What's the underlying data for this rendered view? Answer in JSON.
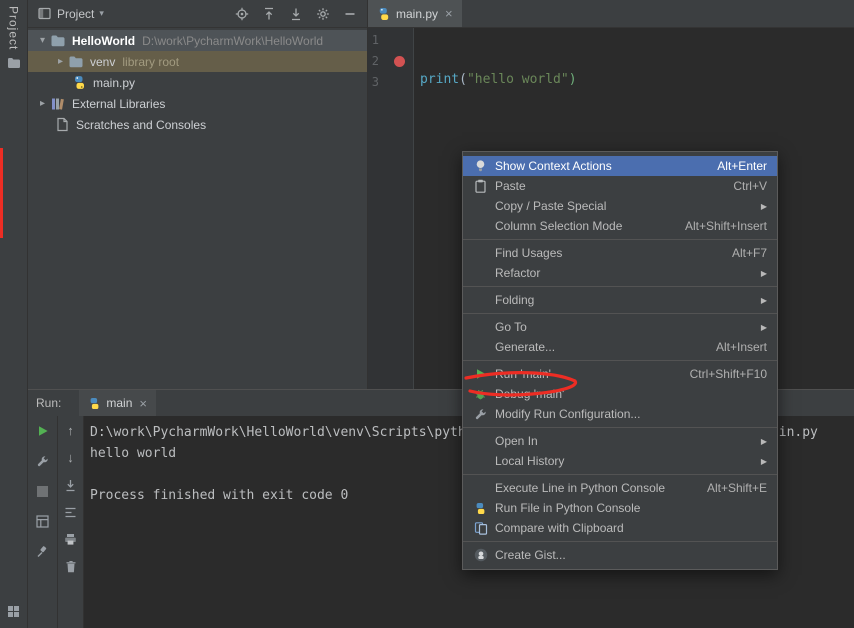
{
  "left_strip": {
    "label": "Project"
  },
  "project_panel": {
    "title": "Project",
    "tree": [
      {
        "name": "HelloWorld",
        "detail": "D:\\work\\PycharmWork\\HelloWorld"
      },
      {
        "name": "venv",
        "detail": "library root"
      },
      {
        "name": "main.py",
        "detail": ""
      },
      {
        "name": "External Libraries",
        "detail": ""
      },
      {
        "name": "Scratches and Consoles",
        "detail": ""
      }
    ]
  },
  "editor": {
    "tab_label": "main.py",
    "line_numbers": [
      "1",
      "2",
      "3"
    ],
    "code": {
      "builtin": "print",
      "open_paren": "(",
      "string": "\"hello world\"",
      "close_paren": ")"
    }
  },
  "context_menu": {
    "items": [
      {
        "label": "Show Context Actions",
        "shortcut": "Alt+Enter"
      },
      {
        "label": "Paste",
        "shortcut": "Ctrl+V"
      },
      {
        "label": "Copy / Paste Special",
        "shortcut": ""
      },
      {
        "label": "Column Selection Mode",
        "shortcut": "Alt+Shift+Insert"
      },
      {
        "label": "Find Usages",
        "shortcut": "Alt+F7"
      },
      {
        "label": "Refactor",
        "shortcut": ""
      },
      {
        "label": "Folding",
        "shortcut": ""
      },
      {
        "label": "Go To",
        "shortcut": ""
      },
      {
        "label": "Generate...",
        "shortcut": "Alt+Insert"
      },
      {
        "label": "Run 'main'",
        "shortcut": "Ctrl+Shift+F10"
      },
      {
        "label": "Debug 'main'",
        "shortcut": ""
      },
      {
        "label": "Modify Run Configuration...",
        "shortcut": ""
      },
      {
        "label": "Open In",
        "shortcut": ""
      },
      {
        "label": "Local History",
        "shortcut": ""
      },
      {
        "label": "Execute Line in Python Console",
        "shortcut": "Alt+Shift+E"
      },
      {
        "label": "Run File in Python Console",
        "shortcut": ""
      },
      {
        "label": "Compare with Clipboard",
        "shortcut": ""
      },
      {
        "label": "Create Gist...",
        "shortcut": ""
      }
    ]
  },
  "run_panel": {
    "label": "Run:",
    "tab_label": "main",
    "console_lines": [
      "D:\\work\\PycharmWork\\HelloWorld\\venv\\Scripts\\python.exe D:/work/PycharmWork/HelloWorld/main.py",
      "hello world",
      "",
      "Process finished with exit code 0"
    ]
  },
  "icons": {
    "caret_down": "▾",
    "chevron_down": "▾",
    "chevron_right": "▸",
    "close": "×",
    "submenu_arrow": "▶",
    "arrow_up": "↑",
    "arrow_down": "↓"
  },
  "colors": {
    "panel_bg": "#3c3f41",
    "editor_bg": "#2b2b2b",
    "menu_selection": "#4b6eaf",
    "selected_row_gray": "#4e5357",
    "selected_row_tan": "#655e49",
    "run_green": "#53b153",
    "breakpoint_red": "#d25252",
    "string_green": "#6a8759",
    "builtin_blue": "#56a8c5",
    "annotation_red": "#ed2d24"
  }
}
